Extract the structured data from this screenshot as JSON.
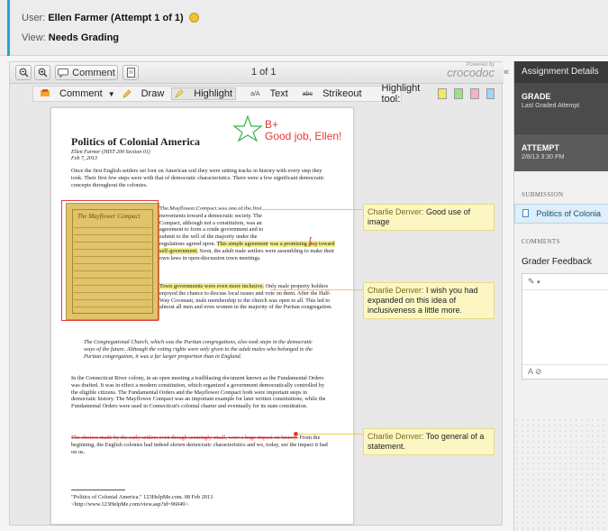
{
  "header": {
    "user_label": "User:",
    "user_name": "Ellen Farmer (Attempt 1 of 1)",
    "view_label": "View:",
    "view_value": "Needs Grading"
  },
  "toolbar": {
    "comment_button": "Comment",
    "page_indicator": "1 of 1",
    "brand": "crocodoc",
    "brand_powered": "Powered by",
    "collapse_glyph": "«"
  },
  "annotation_tools": {
    "comment": "Comment",
    "draw": "Draw",
    "highlight": "Highlight",
    "text": "Text",
    "text_prefix": "a/A",
    "strikeout": "Strikeout",
    "strikeout_prefix": "abc",
    "highlight_tool_label": "Highlight tool:",
    "highlight_colors": [
      "#f6e85c",
      "#9ee08a",
      "#f5b3c1",
      "#9fd4f2"
    ]
  },
  "document": {
    "grade_mark": "B+",
    "grade_note": "Good job, Ellen!",
    "title": "Politics of Colonial America",
    "author_line": "Ellen Farmer (HIST 200 Section 01)",
    "date_line": "Feb 7, 2013",
    "para1": "Once the first English settlers set foot on American soil they were setting tracks in history with every step they took. Their first few steps were with that of democratic characteristics. There were a few significant democratic concepts throughout the colonies.",
    "para2_lines": [
      "The Mayflower Compact was one of the first",
      "movements toward a democratic society. The",
      "Compact, although not a constitution, was an",
      "agreement to form a crude government and to",
      "submit to the will of the majority under the",
      "regulations agreed upon."
    ],
    "para2_highlight_1": "This simple agreement",
    "para2_highlight_2": "was a promising step toward self-government.",
    "para2_rest": "Soon, the adult male settlers were assembling to make their own laws in open-discussion town meetings.",
    "para3_highlight": "Town governments were even more inclusive.",
    "para3_rest": "Only male property holders enjoyed the chance to discuss local issues and vote on them. After the Half-Way Covenant, male membership to the church was open to all. This led to almost all men and even women in the majority of the Puritan congregation.",
    "quote": "The Congregational Church, which was the Puritan congregations, also took steps in the democratic ways of the future. Although the voting rights were only given to the adult males who belonged to the Puritan congregation, it was a far larger proportion than in England.",
    "para4": "In the Connecticut River colony, in an open meeting a trailblazing document known as the Fundamental Orders was drafted. It was in effect a modern constitution, which organized a government democratically controlled by the eligible citizens. The Fundamental Orders and the Mayflower Compact both were important steps in democratic history. The Mayflower Compact was an important example for later written constitutions; while the Fundamental Orders were used in Connecticut's colonial charter and eventually for its state constitution.",
    "para5_strike": "The choices made by the early settlers even though seemingly small, were a huge impact on history.",
    "para5_rest": "From the beginning, the English colonies had indeed shown democratic characteristics and we, today, see the impact it had on us.",
    "footnote": "\"Politics of Colonial America.\" 123HelpMe.com. 08 Feb 2013 <http://www.123HelpMe.com/view.asp?id=96049>.",
    "image_caption": "The Mayflower Compact"
  },
  "comments": [
    {
      "author": "Charlie Denver:",
      "text": "Good use of image"
    },
    {
      "author": "Charlie Denver:",
      "text": "I wish you had expanded on this idea of inclusiveness a little more."
    },
    {
      "author": "Charlie Denver:",
      "text": "Too general of a statement."
    }
  ],
  "panel": {
    "title": "Assignment Details",
    "grade_heading": "GRADE",
    "grade_sub": "Last Graded Attempt",
    "attempt_heading": "ATTEMPT",
    "attempt_date": "2/8/13 3:30 PM",
    "submission_label": "SUBMISSION",
    "submission_file": "Politics of Colonia",
    "comments_label": "COMMENTS",
    "feedback_label": "Grader Feedback",
    "editor_tool": "▾",
    "editor_footer": "A ⊘"
  }
}
